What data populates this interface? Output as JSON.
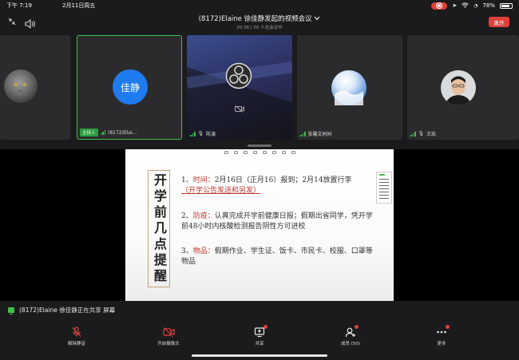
{
  "status_bar": {
    "time": "下午 7:19",
    "date": "2月11日周五",
    "battery": "78%"
  },
  "header": {
    "title": "(8172)Elaine 徐佳静发起的视频会议",
    "chevron": "chevron-down-icon",
    "subtitle": "20:36 | 50 人在会议中",
    "leave_label": "离开"
  },
  "participants": [
    {
      "name": "",
      "avatar": "cat-photo"
    },
    {
      "name": "(8172)Elai...",
      "host_badge": "主持人",
      "avatar_text": "佳静",
      "avatar_color": "#1e7bf0",
      "active": true
    },
    {
      "name": "陈演",
      "avatar": "obs-logo",
      "camera": "camera-off-icon"
    },
    {
      "name": "张馨文妈妈",
      "avatar": "sky-photo"
    },
    {
      "name": "王凯",
      "avatar": "man-photo"
    }
  ],
  "slide": {
    "vertical_title": "开学前几点提醒",
    "points": [
      {
        "num": "1、",
        "key": "时间：",
        "text": "2月16日（正月16）报到；2月14放置行李",
        "link": "（开学公告发送和另发）"
      },
      {
        "num": "2、",
        "key": "防疫：",
        "text": "认真完成开学前健康日报；假期出省同学，凭开学前48小时内核酸检测报告阴性方可进校"
      },
      {
        "num": "3、",
        "key": "物品：",
        "text": "假期作业、学生证、饭卡、市民卡、校服、口罩等物品"
      }
    ]
  },
  "share_notice": "(8172)Elaine 徐佳静正在共享 屏幕",
  "toolbar": {
    "unmute": "解除静音",
    "camera": "开启摄像头",
    "share": "共享",
    "members": "成员 (50)",
    "more": "更多"
  },
  "colors": {
    "host_green": "#2a9c3f",
    "leave_red": "#e0403a",
    "avatar_blue": "#1e7bf0",
    "slide_red": "#c0392b"
  }
}
